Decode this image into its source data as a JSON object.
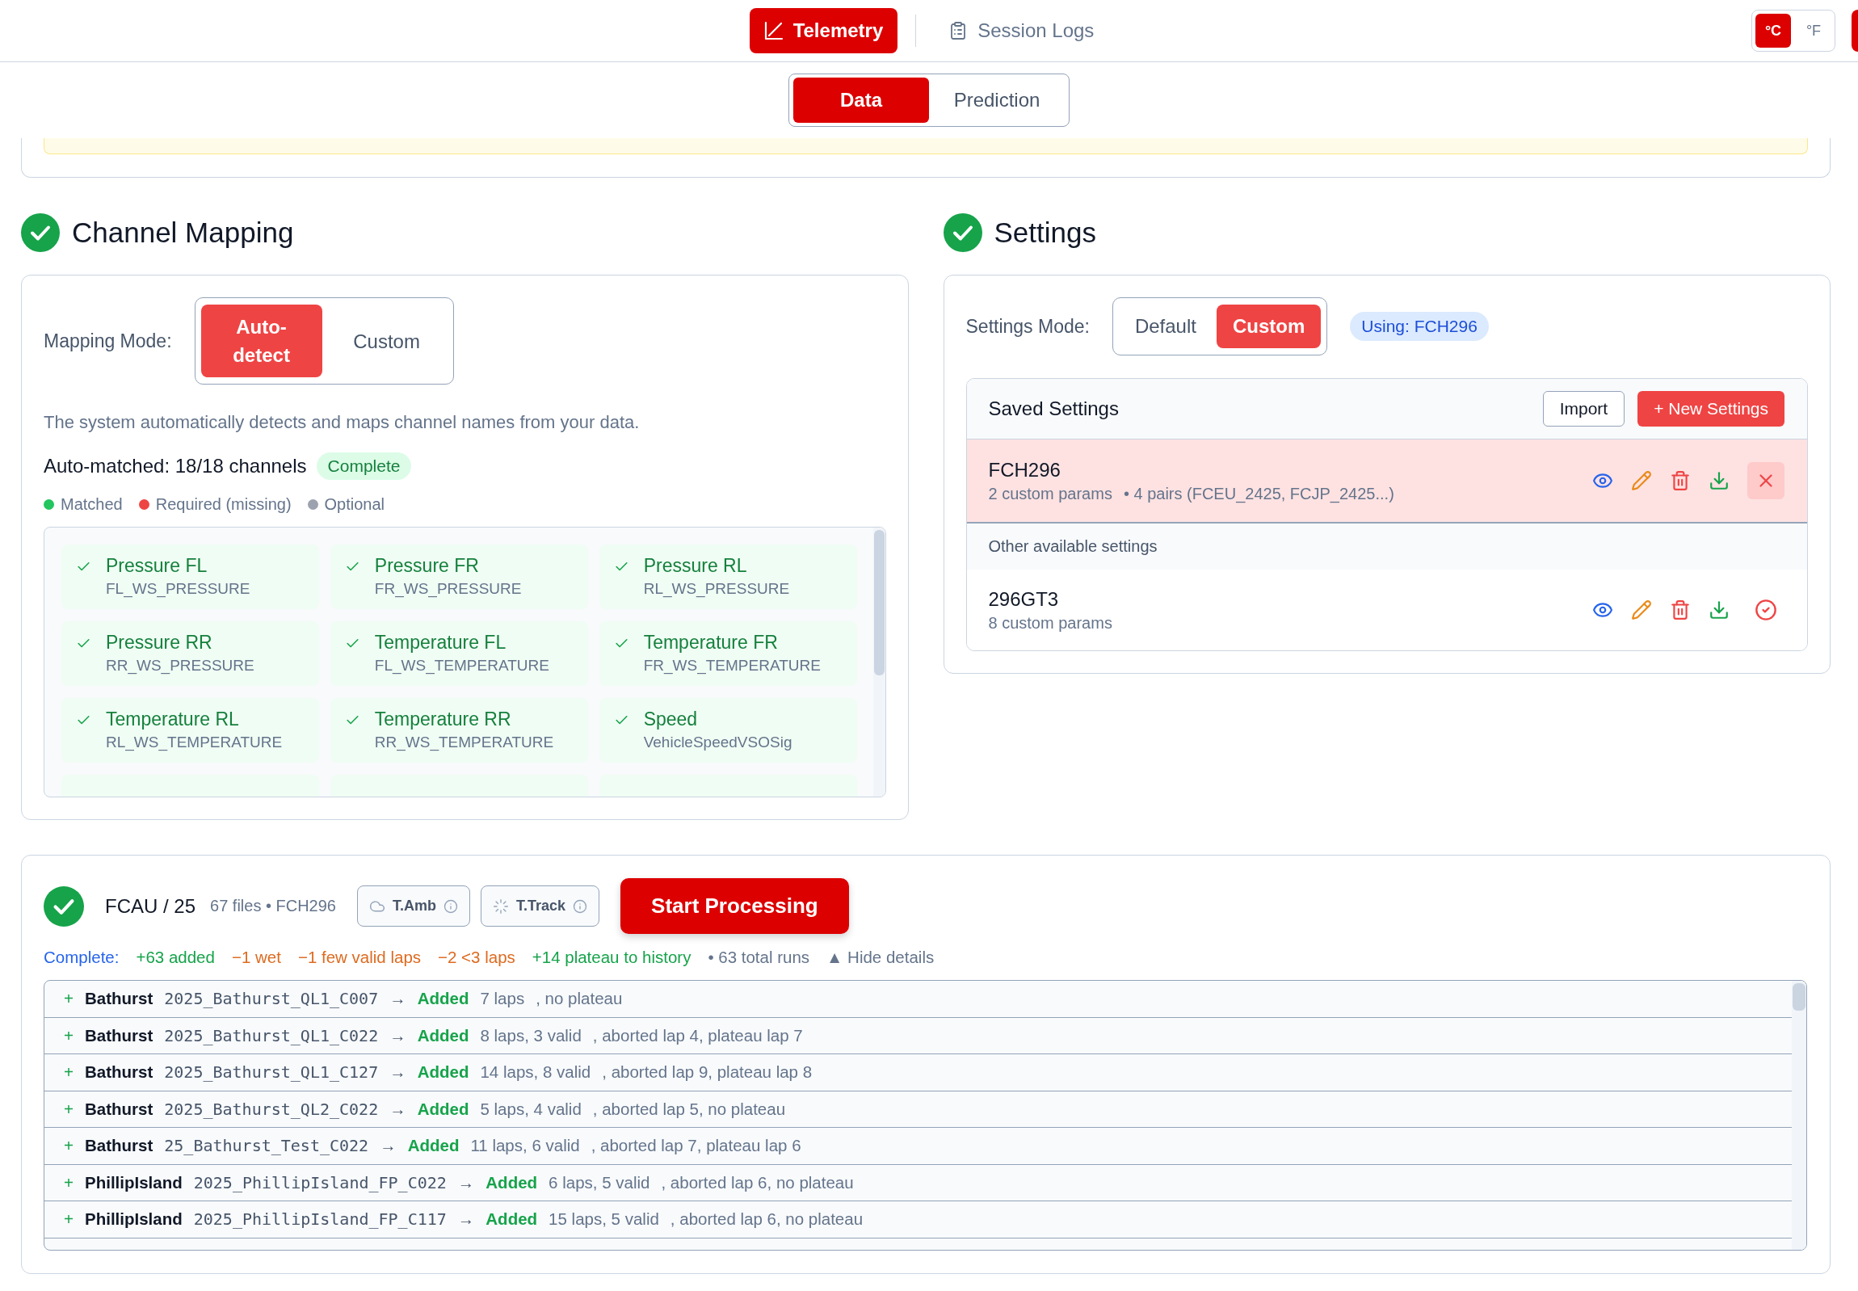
{
  "header": {
    "nav": [
      {
        "label": "Telemetry",
        "selected": true
      },
      {
        "label": "Session Logs",
        "selected": false
      }
    ],
    "units": [
      {
        "label": "°C",
        "selected": true
      },
      {
        "label": "°F",
        "selected": false
      }
    ]
  },
  "view_tabs": [
    {
      "label": "Data",
      "selected": true
    },
    {
      "label": "Prediction",
      "selected": false
    }
  ],
  "channel_mapping": {
    "title": "Channel Mapping",
    "complete": true,
    "mode_label": "Mapping Mode:",
    "modes": [
      {
        "label": "Auto-detect",
        "selected": true
      },
      {
        "label": "Custom",
        "selected": false
      }
    ],
    "description": "The system automatically detects and maps channel names from your data.",
    "summary": "Auto-matched: 18/18 channels",
    "badge": "Complete",
    "legend": [
      {
        "label": "Matched",
        "color": "#22c55e"
      },
      {
        "label": "Required (missing)",
        "color": "#ef4444"
      },
      {
        "label": "Optional",
        "color": "#9ca3af"
      }
    ],
    "channels": [
      {
        "name": "Pressure FL",
        "channel": "FL_WS_PRESSURE",
        "matched": true
      },
      {
        "name": "Pressure FR",
        "channel": "FR_WS_PRESSURE",
        "matched": true
      },
      {
        "name": "Pressure RL",
        "channel": "RL_WS_PRESSURE",
        "matched": true
      },
      {
        "name": "Pressure RR",
        "channel": "RR_WS_PRESSURE",
        "matched": true
      },
      {
        "name": "Temperature FL",
        "channel": "FL_WS_TEMPERATURE",
        "matched": true
      },
      {
        "name": "Temperature FR",
        "channel": "FR_WS_TEMPERATURE",
        "matched": true
      },
      {
        "name": "Temperature RL",
        "channel": "RL_WS_TEMPERATURE",
        "matched": true
      },
      {
        "name": "Temperature RR",
        "channel": "RR_WS_TEMPERATURE",
        "matched": true
      },
      {
        "name": "Speed",
        "channel": "VehicleSpeedVSOSig",
        "matched": true
      },
      {
        "matched": true
      },
      {
        "matched": true
      },
      {
        "matched": true
      }
    ]
  },
  "settings": {
    "title": "Settings",
    "complete": true,
    "mode_label": "Settings Mode:",
    "modes": [
      {
        "label": "Default",
        "selected": false
      },
      {
        "label": "Custom",
        "selected": true
      }
    ],
    "using": "Using: FCH296",
    "saved": {
      "title": "Saved Settings",
      "import_button": "Import",
      "new_button": "+ New Settings",
      "other_label": "Other available settings",
      "items": [
        {
          "name": "FCH296",
          "params": "2 custom params",
          "pairs": "• 4 pairs (FCEU_2425, FCJP_2425...)",
          "selected": true
        },
        {
          "name": "296GT3",
          "params": "8 custom params",
          "selected": false
        }
      ]
    }
  },
  "processing": {
    "title": "FCAU / 25",
    "meta": "67 files • FCH296",
    "complete": true,
    "chips": [
      "T.Amb",
      "T.Track"
    ],
    "start_button": "Start Processing",
    "status_label": "Complete:",
    "results": [
      {
        "text": "+63 added",
        "kind": "gain"
      },
      {
        "text": "−1 wet",
        "kind": "loss"
      },
      {
        "text": "−1 few valid laps",
        "kind": "loss"
      },
      {
        "text": "−2 <3 laps",
        "kind": "loss"
      },
      {
        "text": "+14 plateau to history",
        "kind": "gain"
      },
      {
        "text": "• 63 total runs",
        "kind": "info"
      }
    ],
    "toggle": "▲ Hide details",
    "runs": [
      {
        "sign": "+",
        "track": "Bathurst",
        "file": "2025_Bathurst_QL1_C007",
        "arrow": "→",
        "status": "Added",
        "laps": "7 laps",
        "note": ", no plateau"
      },
      {
        "sign": "+",
        "track": "Bathurst",
        "file": "2025_Bathurst_QL1_C022",
        "arrow": "→",
        "status": "Added",
        "laps": "8 laps, 3 valid",
        "note": ", aborted lap 4, plateau lap 7"
      },
      {
        "sign": "+",
        "track": "Bathurst",
        "file": "2025_Bathurst_QL1_C127",
        "arrow": "→",
        "status": "Added",
        "laps": "14 laps, 8 valid",
        "note": ", aborted lap 9, plateau lap 8"
      },
      {
        "sign": "+",
        "track": "Bathurst",
        "file": "2025_Bathurst_QL2_C022",
        "arrow": "→",
        "status": "Added",
        "laps": "5 laps, 4 valid",
        "note": ", aborted lap 5, no plateau"
      },
      {
        "sign": "+",
        "track": "Bathurst",
        "file": "25_Bathurst_Test_C022",
        "arrow": "→",
        "status": "Added",
        "laps": "11 laps, 6 valid",
        "note": ", aborted lap 7, plateau lap 6"
      },
      {
        "sign": "+",
        "track": "PhillipIsland",
        "file": "2025_PhillipIsland_FP_C022",
        "arrow": "→",
        "status": "Added",
        "laps": "6 laps, 5 valid",
        "note": ", aborted lap 6, no plateau"
      },
      {
        "sign": "+",
        "track": "PhillipIsland",
        "file": "2025_PhillipIsland_FP_C117",
        "arrow": "→",
        "status": "Added",
        "laps": "15 laps, 5 valid",
        "note": ", aborted lap 6, no plateau"
      }
    ]
  }
}
